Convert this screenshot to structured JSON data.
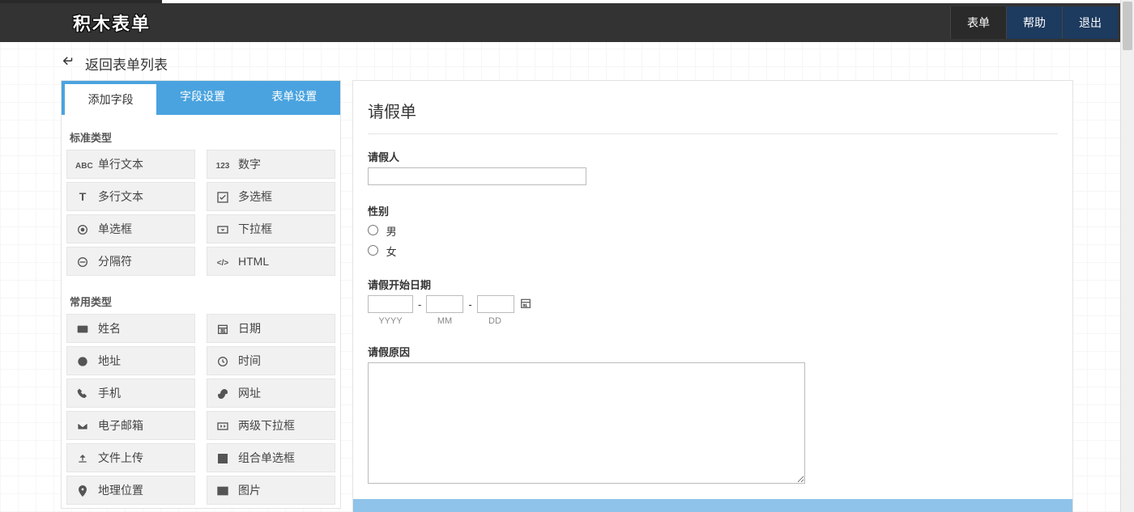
{
  "header": {
    "logo": "积木表单",
    "nav": {
      "forms": "表单",
      "help": "帮助",
      "logout": "退出"
    }
  },
  "back_link": "返回表单列表",
  "tabs": {
    "add_field": "添加字段",
    "field_settings": "字段设置",
    "form_settings": "表单设置"
  },
  "groups": {
    "standard": {
      "title": "标准类型",
      "items": {
        "single_text": "单行文本",
        "number": "数字",
        "multi_text": "多行文本",
        "checkbox": "多选框",
        "radio": "单选框",
        "dropdown": "下拉框",
        "divider": "分隔符",
        "html": "HTML"
      }
    },
    "common": {
      "title": "常用类型",
      "items": {
        "name": "姓名",
        "date": "日期",
        "address": "地址",
        "time": "时间",
        "phone": "手机",
        "url": "网址",
        "email": "电子邮箱",
        "cascader": "两级下拉框",
        "upload": "文件上传",
        "combo_radio": "组合单选框",
        "geo": "地理位置",
        "image": "图片"
      }
    }
  },
  "form": {
    "title": "请假单",
    "fields": {
      "applicant": {
        "label": "请假人"
      },
      "gender": {
        "label": "性别",
        "options": {
          "male": "男",
          "female": "女"
        }
      },
      "start_date": {
        "label": "请假开始日期",
        "hints": {
          "y": "YYYY",
          "m": "MM",
          "d": "DD"
        }
      },
      "reason": {
        "label": "请假原因"
      }
    }
  }
}
